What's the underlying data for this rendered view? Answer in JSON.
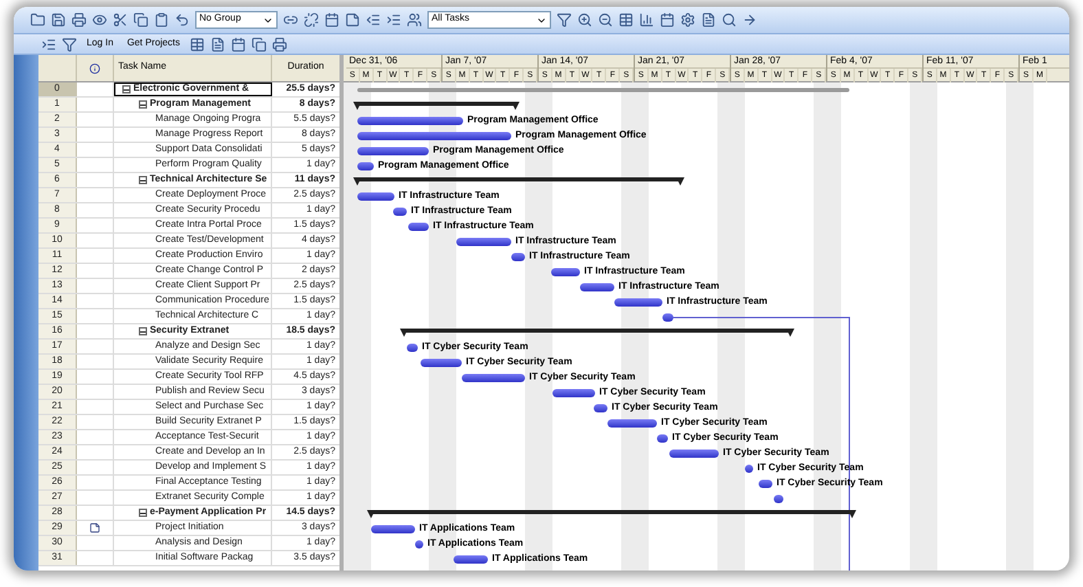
{
  "toolbar": {
    "group_select": "No Group",
    "filter_select": "All Tasks",
    "buttons": [
      "Log In",
      "Get Projects"
    ]
  },
  "columns": {
    "name": "Task Name",
    "duration": "Duration"
  },
  "timeline": [
    {
      "label": "Dec 31, '06",
      "days": [
        "S",
        "M",
        "T",
        "W",
        "T",
        "F",
        "S"
      ]
    },
    {
      "label": "Jan 7, '07",
      "days": [
        "S",
        "M",
        "T",
        "W",
        "T",
        "F",
        "S"
      ]
    },
    {
      "label": "Jan 14, '07",
      "days": [
        "S",
        "M",
        "T",
        "W",
        "T",
        "F",
        "S"
      ]
    },
    {
      "label": "Jan 21, '07",
      "days": [
        "S",
        "M",
        "T",
        "W",
        "T",
        "F",
        "S"
      ]
    },
    {
      "label": "Jan 28, '07",
      "days": [
        "S",
        "M",
        "T",
        "W",
        "T",
        "F",
        "S"
      ]
    },
    {
      "label": "Feb 4, '07",
      "days": [
        "S",
        "M",
        "T",
        "W",
        "T",
        "F",
        "S"
      ]
    },
    {
      "label": "Feb 11, '07",
      "days": [
        "S",
        "M",
        "T",
        "W",
        "T",
        "F",
        "S"
      ]
    },
    {
      "label": "Feb 1",
      "days": [
        "S",
        "M"
      ]
    }
  ],
  "tasks": [
    {
      "id": "0",
      "name": "Electronic Government &",
      "duration": "25.5 days?",
      "kind": "project",
      "expanded": true,
      "selected": true,
      "note": false,
      "children": [
        {
          "id": "1",
          "name": "Program Management",
          "duration": "8 days?",
          "kind": "summary",
          "expanded": true,
          "selected": false,
          "note": false,
          "children": [
            {
              "id": "2",
              "name": "Manage Ongoing Progra",
              "duration": "5.5 days?",
              "kind": "task",
              "selected": false,
              "note": false,
              "resource": "Program Management Office"
            },
            {
              "id": "3",
              "name": "Manage Progress Report",
              "duration": "8 days?",
              "kind": "task",
              "selected": false,
              "note": false,
              "resource": "Program Management Office"
            },
            {
              "id": "4",
              "name": "Support Data Consolidati",
              "duration": "5 days?",
              "kind": "task",
              "selected": false,
              "note": false,
              "resource": "Program Management Office"
            },
            {
              "id": "5",
              "name": "Perform Program Quality",
              "duration": "1 day?",
              "kind": "task",
              "selected": false,
              "note": false,
              "resource": "Program Management Office"
            }
          ]
        },
        {
          "id": "6",
          "name": "Technical Architecture Se",
          "duration": "11 days?",
          "kind": "summary",
          "expanded": true,
          "selected": false,
          "note": false,
          "children": [
            {
              "id": "7",
              "name": "Create Deployment Proce",
              "duration": "2.5 days?",
              "kind": "task",
              "selected": false,
              "note": false,
              "resource": "IT Infrastructure Team"
            },
            {
              "id": "8",
              "name": "Create Security Procedu",
              "duration": "1 day?",
              "kind": "task",
              "selected": false,
              "note": false,
              "resource": "IT Infrastructure Team"
            },
            {
              "id": "9",
              "name": "Create Intra Portal Proce",
              "duration": "1.5 days?",
              "kind": "task",
              "selected": false,
              "note": false,
              "resource": "IT Infrastructure Team"
            },
            {
              "id": "10",
              "name": "Create Test/Development",
              "duration": "4 days?",
              "kind": "task",
              "selected": false,
              "note": false,
              "resource": "IT Infrastructure Team"
            },
            {
              "id": "11",
              "name": "Create Production Enviro",
              "duration": "1 day?",
              "kind": "task",
              "selected": false,
              "note": false,
              "resource": "IT Infrastructure Team"
            },
            {
              "id": "12",
              "name": "Create Change Control P",
              "duration": "2 days?",
              "kind": "task",
              "selected": false,
              "note": false,
              "resource": "IT Infrastructure Team"
            },
            {
              "id": "13",
              "name": "Create Client Support Pr",
              "duration": "2.5 days?",
              "kind": "task",
              "selected": false,
              "note": false,
              "resource": "IT Infrastructure Team"
            },
            {
              "id": "14",
              "name": "Communication Procedure",
              "duration": "1.5 days?",
              "kind": "task",
              "selected": false,
              "note": false,
              "resource": "IT Infrastructure Team"
            },
            {
              "id": "15",
              "name": "Technical Architecture C",
              "duration": "1 day?",
              "kind": "task",
              "selected": false,
              "note": false
            }
          ]
        },
        {
          "id": "16",
          "name": "Security Extranet",
          "duration": "18.5 days?",
          "kind": "summary",
          "expanded": true,
          "selected": false,
          "note": false,
          "children": [
            {
              "id": "17",
              "name": "Analyze and Design Sec",
              "duration": "1 day?",
              "kind": "task",
              "selected": false,
              "note": false,
              "resource": "IT Cyber Security Team"
            },
            {
              "id": "18",
              "name": "Validate Security Require",
              "duration": "1 day?",
              "kind": "task",
              "selected": false,
              "note": false,
              "resource": "IT Cyber Security Team"
            },
            {
              "id": "19",
              "name": "Create Security Tool RFP",
              "duration": "4.5 days?",
              "kind": "task",
              "selected": false,
              "note": false,
              "resource": "IT Cyber Security Team"
            },
            {
              "id": "20",
              "name": "Publish and Review Secu",
              "duration": "3 days?",
              "kind": "task",
              "selected": false,
              "note": false,
              "resource": "IT Cyber Security Team"
            },
            {
              "id": "21",
              "name": "Select and Purchase Sec",
              "duration": "1 day?",
              "kind": "task",
              "selected": false,
              "note": false,
              "resource": "IT Cyber Security Team"
            },
            {
              "id": "22",
              "name": "Build Security Extranet P",
              "duration": "1.5 days?",
              "kind": "task",
              "selected": false,
              "note": false,
              "resource": "IT Cyber Security Team"
            },
            {
              "id": "23",
              "name": "Acceptance Test-Securit",
              "duration": "1 day?",
              "kind": "task",
              "selected": false,
              "note": false,
              "resource": "IT Cyber Security Team"
            },
            {
              "id": "24",
              "name": "Create and Develop an In",
              "duration": "2.5 days?",
              "kind": "task",
              "selected": false,
              "note": false,
              "resource": "IT Cyber Security Team"
            },
            {
              "id": "25",
              "name": "Develop and Implement S",
              "duration": "1 day?",
              "kind": "task",
              "selected": false,
              "note": false,
              "resource": "IT Cyber Security Team"
            },
            {
              "id": "26",
              "name": "Final Acceptance Testing",
              "duration": "1 day?",
              "kind": "task",
              "selected": false,
              "note": false,
              "resource": "IT Cyber Security Team"
            },
            {
              "id": "27",
              "name": "Extranet Security Comple",
              "duration": "1 day?",
              "kind": "task",
              "selected": false,
              "note": false
            }
          ]
        },
        {
          "id": "28",
          "name": "e-Payment Application Pr",
          "duration": "14.5 days?",
          "kind": "summary",
          "expanded": true,
          "selected": false,
          "note": false,
          "children": [
            {
              "id": "29",
              "name": "Project Initiation",
              "duration": "3 days?",
              "kind": "task",
              "selected": false,
              "note": true,
              "resource": "IT Applications Team"
            },
            {
              "id": "30",
              "name": "Analysis and Design",
              "duration": "1 day?",
              "kind": "task",
              "selected": false,
              "note": false,
              "resource": "IT Applications Team"
            },
            {
              "id": "31",
              "name": "Initial Software Packag",
              "duration": "3.5 days?",
              "kind": "task",
              "selected": false,
              "note": false,
              "resource": "IT Applications Team"
            }
          ]
        }
      ]
    }
  ]
}
